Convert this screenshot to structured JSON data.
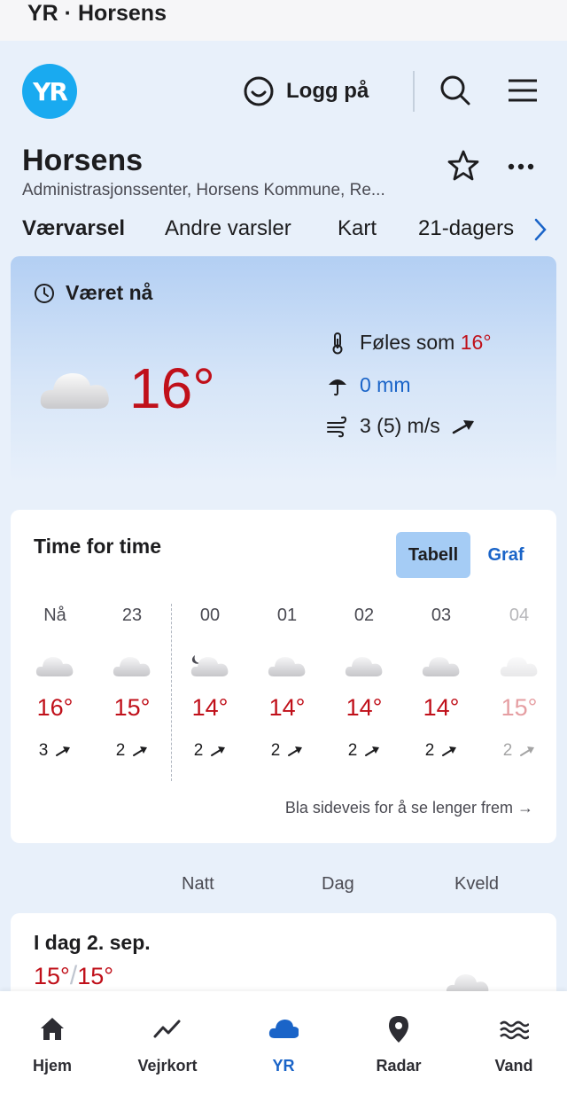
{
  "window": {
    "title": "YR · Horsens"
  },
  "header": {
    "logo_text": "YR",
    "login_label": "Logg på",
    "icons": [
      "smiley-icon",
      "search-icon",
      "menu-icon"
    ]
  },
  "location": {
    "name": "Horsens",
    "subtitle": "Administrasjonssenter, Horsens Kommune, Re..."
  },
  "tabs": [
    {
      "label": "Værvarsel",
      "active": true
    },
    {
      "label": "Andre varsler",
      "active": false
    },
    {
      "label": "Kart",
      "active": false
    },
    {
      "label": "21-dagers",
      "active": false
    }
  ],
  "now": {
    "heading": "Været nå",
    "temperature": "16°",
    "feels_prefix": "Føles som",
    "feels_value": "16°",
    "precipitation": "0 mm",
    "wind": "3 (5) m/s"
  },
  "hourly": {
    "title": "Time for time",
    "toggle_table": "Tabell",
    "toggle_graph": "Graf",
    "hours": [
      {
        "hour": "Nå",
        "icon": "cloud-icon",
        "temp": "16°",
        "wind": "3"
      },
      {
        "hour": "23",
        "icon": "cloud-icon",
        "temp": "15°",
        "wind": "2"
      },
      {
        "hour": "00",
        "icon": "cloud-moon-icon",
        "temp": "14°",
        "wind": "2"
      },
      {
        "hour": "01",
        "icon": "cloud-icon",
        "temp": "14°",
        "wind": "2"
      },
      {
        "hour": "02",
        "icon": "cloud-icon",
        "temp": "14°",
        "wind": "2"
      },
      {
        "hour": "03",
        "icon": "cloud-icon",
        "temp": "14°",
        "wind": "2"
      },
      {
        "hour": "04",
        "icon": "cloud-icon",
        "temp": "15°",
        "wind": "2"
      }
    ],
    "scroll_hint": "Bla sideveis for å se lenger frem →"
  },
  "periods": [
    "Natt",
    "Dag",
    "Kveld"
  ],
  "day": {
    "title": "I dag 2. sep.",
    "max": "15°",
    "separator": "/",
    "min": "15°"
  },
  "bottom_nav": [
    {
      "label": "Hjem",
      "icon": "home-icon"
    },
    {
      "label": "Vejrkort",
      "icon": "chart-line-icon"
    },
    {
      "label": "YR",
      "icon": "cloud-icon",
      "active": true
    },
    {
      "label": "Radar",
      "icon": "location-pin-icon"
    },
    {
      "label": "Vand",
      "icon": "waves-icon"
    }
  ],
  "colors": {
    "temp_warm": "#c0101a",
    "accent": "#1a64c8",
    "logo": "#19aaf0"
  }
}
